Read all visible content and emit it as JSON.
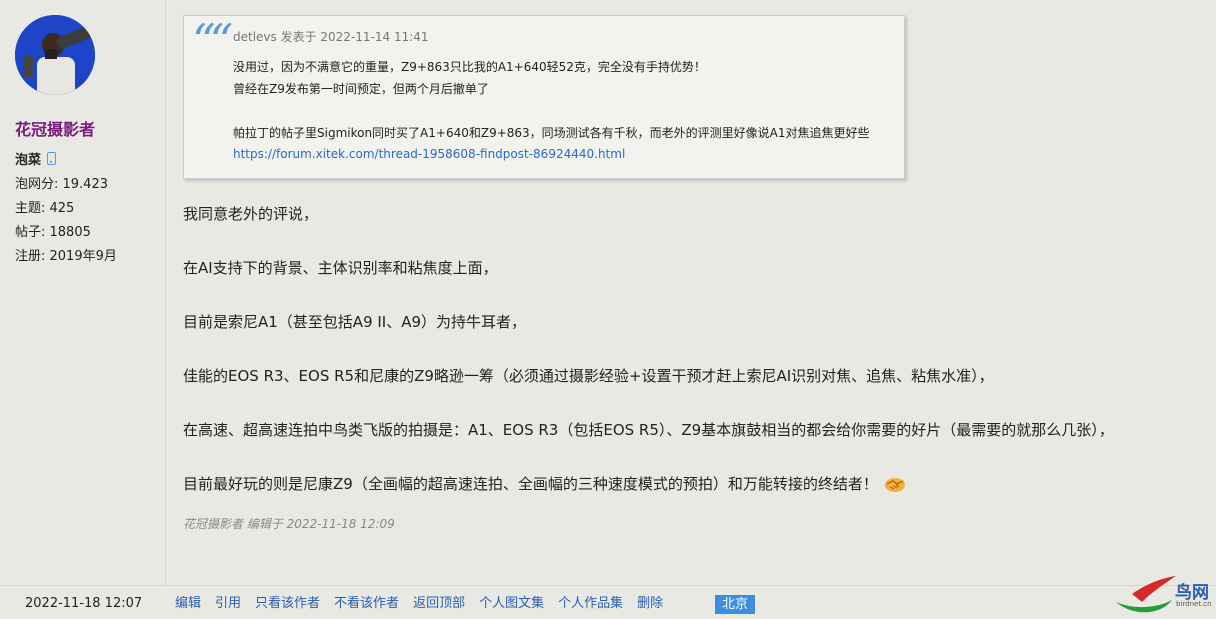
{
  "author": {
    "name": "花冠摄影者",
    "rank": "泡菜",
    "stats": [
      "泡网分: 19.423",
      "主题: 425",
      "帖子: 18805",
      "注册: 2019年9月"
    ]
  },
  "quote": {
    "header": "detlevs 发表于 2022-11-14 11:41",
    "lines": [
      "没用过，因为不满意它的重量，Z9+863只比我的A1+640轻52克，完全没有手持优势！",
      "曾经在Z9发布第一时间预定，但两个月后撤单了",
      "帕拉丁的帖子里Sigmikon同时买了A1+640和Z9+863，同场测试各有千秋，而老外的评测里好像说A1对焦追焦更好些"
    ],
    "link": "https://forum.xitek.com/thread-1958608-findpost-86924440.html"
  },
  "body": [
    "我同意老外的评说，",
    "在AI支持下的背景、主体识别率和粘焦度上面，",
    "目前是索尼A1（甚至包括A9 II、A9）为持牛耳者，",
    "佳能的EOS R3、EOS R5和尼康的Z9略逊一筹（必须通过摄影经验+设置干预才赶上索尼AI识别对焦、追焦、粘焦水准），",
    "在高速、超高速连拍中鸟类飞版的拍摄是：A1、EOS R3（包括EOS R5）、Z9基本旗鼓相当的都会给你需要的好片（最需要的就那么几张），",
    "目前最好玩的则是尼康Z9（全画幅的超高速连拍、全画幅的三种速度模式的预拍）和万能转接的终结者！"
  ],
  "edit_note": "花冠摄影者 编辑于 2022-11-18 12:09",
  "footer": {
    "post_time": "2022-11-18 12:07",
    "actions": [
      "编辑",
      "引用",
      "只看该作者",
      "不看该作者",
      "返回顶部",
      "个人图文集",
      "个人作品集",
      "删除"
    ],
    "location": "北京"
  },
  "logo": {
    "text": "鸟网",
    "sub": "birdnet.cn"
  },
  "colors": {
    "username": "#7c1a7c",
    "link": "#2a5db0",
    "badge": "#3d8fdb",
    "background": "#e9e9e4"
  }
}
